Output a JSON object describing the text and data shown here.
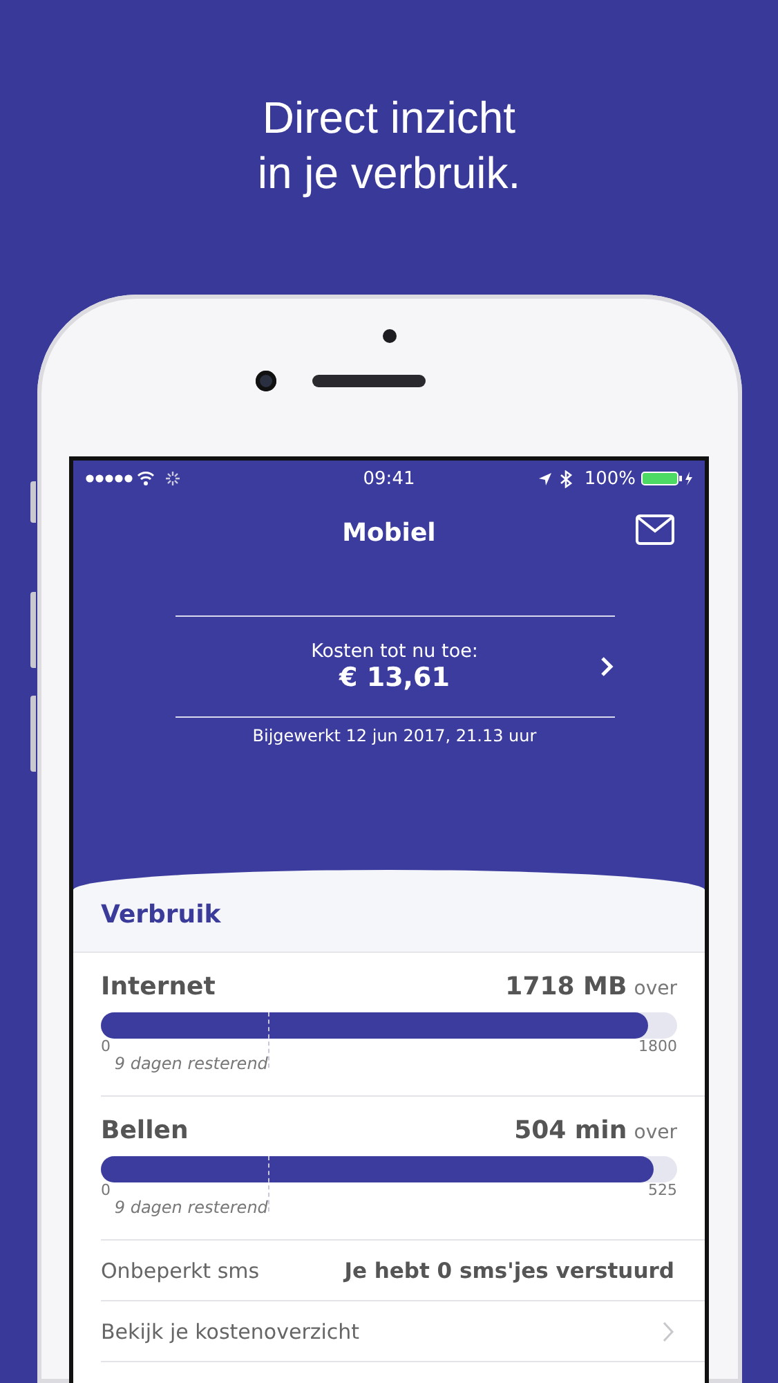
{
  "headline": [
    "Direct inzicht",
    "in je verbruik."
  ],
  "status_bar": {
    "time": "09:41",
    "battery": "100%"
  },
  "header": {
    "title": "Mobiel",
    "costs_label": "Kosten tot nu toe:",
    "costs_amount": "€ 13,61",
    "updated": "Bijgewerkt 12 jun 2017, 21.13 uur"
  },
  "section": {
    "title": "Verbruik"
  },
  "usage": [
    {
      "name": "Internet",
      "amount": "1718 MB",
      "suffix": "over",
      "level": 0.95,
      "min": "0",
      "max": "1800",
      "period": {
        "label": "9 dagen resterend",
        "level": 0.29
      }
    },
    {
      "name": "Bellen",
      "amount": "504 min",
      "suffix": "over",
      "level": 0.96,
      "min": "0",
      "max": "525",
      "period": {
        "label": "9 dagen resterend",
        "level": 0.29
      }
    }
  ],
  "rows": [
    {
      "kind": "info",
      "label": "Onbeperkt sms",
      "value": "Je hebt 0 sms'jes verstuurd"
    },
    {
      "kind": "link",
      "label": "Bekijk je kostenoverzicht"
    }
  ]
}
